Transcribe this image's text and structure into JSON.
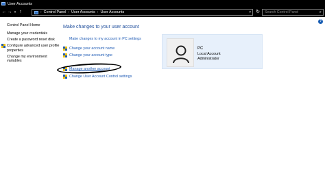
{
  "window": {
    "title": "User Accounts"
  },
  "navbar": {
    "back": "←",
    "forward": "→",
    "recent": "▾",
    "up": "↑",
    "breadcrumb": [
      "Control Panel",
      "User Accounts",
      "User Accounts"
    ],
    "separator": "›",
    "dropdown": "▾",
    "refresh": "↻",
    "search_placeholder": "Search Control Panel",
    "search_glyph": "⌕"
  },
  "help": "?",
  "sidebar": {
    "home": "Control Panel Home",
    "links": [
      "Manage your credentials",
      "Create a password reset disk",
      "Configure advanced user profile properties",
      "Change my environment variables"
    ]
  },
  "main": {
    "title": "Make changes to your user account",
    "pc_settings_link": "Make changes to my account in PC settings",
    "tasks": [
      "Change your account name",
      "Change your account type",
      "Manage another account",
      "Change User Account Control settings"
    ]
  },
  "account": {
    "name": "PC",
    "type": "Local Account",
    "role": "Administrator"
  },
  "colors": {
    "link": "#1f5bb5",
    "title": "#1f4e9c",
    "panel": "#e7f0fb",
    "titlebar": "#000000"
  }
}
